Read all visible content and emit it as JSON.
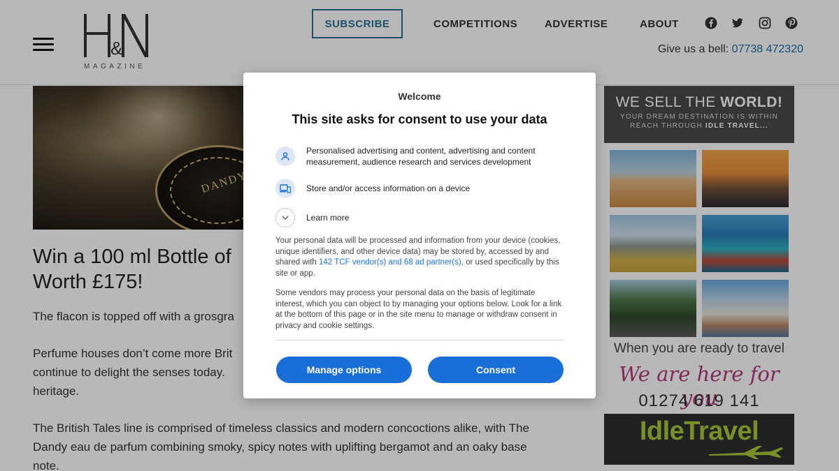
{
  "header": {
    "logo_text": "H&N",
    "logo_subtext": "MAGAZINE",
    "nav": {
      "subscribe": "SUBSCRIBE",
      "competitions": "COMPETITIONS",
      "advertise": "ADVERTISE",
      "about": "ABOUT"
    },
    "social_icons": [
      "facebook-icon",
      "twitter-icon",
      "instagram-icon",
      "pinterest-icon"
    ],
    "phone_label": "Give us a bell:",
    "phone_number": "07738 472320"
  },
  "article": {
    "hero_cap_text": "DANDY",
    "title_line1": "Win a 100 ml Bottle of",
    "title_line2": "Worth £175!",
    "para1": "The flacon is topped off with a grosgra",
    "para2_line1": "Perfume houses don’t come more Brit",
    "para2_line2": "continue to delight the senses today.",
    "para2_line3": "heritage.",
    "para3_line1": "The British Tales line is comprised of timeless classics and modern concoctions alike, with The",
    "para3_line2": "Dandy eau de parfum combining smoky, spicy notes with uplifting bergamot and an oaky base",
    "para3_line3": "note."
  },
  "ad": {
    "headline_plain": "WE SELL THE ",
    "headline_bold": "WORLD!",
    "tagline_line1": "YOUR DREAM DESTINATION IS WITHIN",
    "tagline_line2_plain": "REACH THROUGH ",
    "tagline_line2_bold": "IDLE TRAVEL...",
    "ready": "When you are ready to travel",
    "script": "We are here for you",
    "phone": "01274 619 141",
    "brand": "IdleTravel"
  },
  "consent": {
    "welcome": "Welcome",
    "title": "This site asks for consent to use your data",
    "purposes": [
      {
        "icon": "person-icon",
        "text": "Personalised advertising and content, advertising and content measurement, audience research and services development"
      },
      {
        "icon": "devices-icon",
        "text": "Store and/or access information on a device"
      }
    ],
    "learn_more": "Learn more",
    "para1_before": "Your personal data will be processed and information from your device (cookies, unique identifiers, and other device data) may be stored by, accessed by and shared with ",
    "para1_link": "142 TCF vendor(s) and 68 ad partner(s)",
    "para1_after": ", or used specifically by this site or app.",
    "para2": "Some vendors may process your personal data on the basis of legitimate interest, which you can object to by managing your options below. Look for a link at the bottom of this page or in the site menu to manage or withdraw consent in privacy and cookie settings.",
    "manage_button": "Manage options",
    "consent_button": "Consent"
  },
  "colors": {
    "accent_blue": "#1a6ed8",
    "subscribe_border": "#2a6f93",
    "ad_brand_green": "#a8c63a",
    "ad_script_pink": "#b03a7a"
  }
}
